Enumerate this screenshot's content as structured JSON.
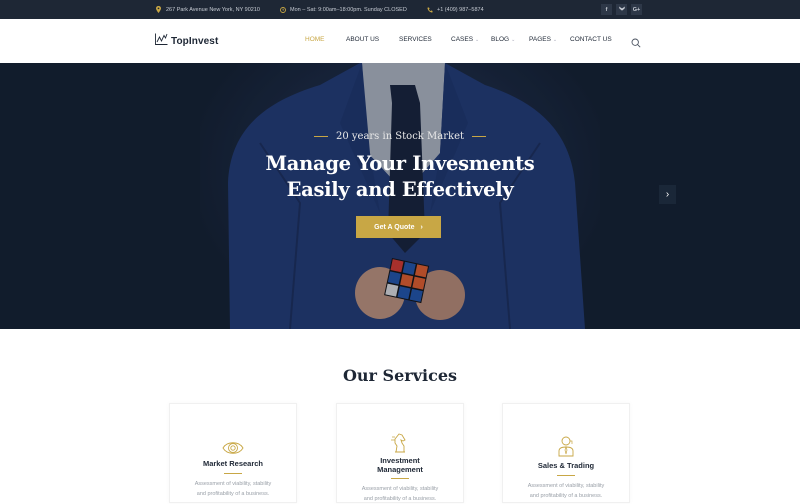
{
  "topbar": {
    "address": "267 Park Avenue New York, NY 90210",
    "hours": "Mon – Sat: 9:00am–18:00pm. Sunday CLOSED",
    "phone": "+1 (409) 987–5874",
    "social": [
      {
        "name": "facebook",
        "glyph": "f"
      },
      {
        "name": "twitter",
        "glyph": "t"
      },
      {
        "name": "google-plus",
        "glyph": "G+"
      }
    ]
  },
  "header": {
    "logo_text": "TopInvest",
    "nav": [
      {
        "label": "HOME",
        "active": true,
        "dropdown": false
      },
      {
        "label": "ABOUT US",
        "active": false,
        "dropdown": false
      },
      {
        "label": "SERVICES",
        "active": false,
        "dropdown": false
      },
      {
        "label": "CASES",
        "active": false,
        "dropdown": true
      },
      {
        "label": "BLOG",
        "active": false,
        "dropdown": true
      },
      {
        "label": "PAGES",
        "active": false,
        "dropdown": true
      },
      {
        "label": "CONTACT US",
        "active": false,
        "dropdown": false
      }
    ],
    "chevron_glyph": "⌄",
    "search_icon": "search-icon"
  },
  "hero": {
    "eyebrow": "20 years in Stock Market",
    "headline_line1": "Manage Your Invesments",
    "headline_line2": "Easily and Effectively",
    "cta_label": "Get A Quote",
    "cta_arrow": "›",
    "next_arrow": "›"
  },
  "services": {
    "title": "Our Services",
    "cards": [
      {
        "title": "Market Research",
        "icon": "eye-icon",
        "desc_line1": "Assessment of viability, stability",
        "desc_line2": "and profitability of a business."
      },
      {
        "title_line1": "Investment",
        "title_line2": "Management",
        "icon": "chess-knight-icon",
        "desc_line1": "Assessment of viability, stability",
        "desc_line2": "and profitability of a business."
      },
      {
        "title": "Sales & Trading",
        "icon": "businessman-icon",
        "desc_line1": "Assessment of viability, stability",
        "desc_line2": "and profitability of a business."
      }
    ]
  },
  "colors": {
    "accent": "#c8a745",
    "dark": "#1e2735",
    "hero_bg": "#131f2f"
  }
}
